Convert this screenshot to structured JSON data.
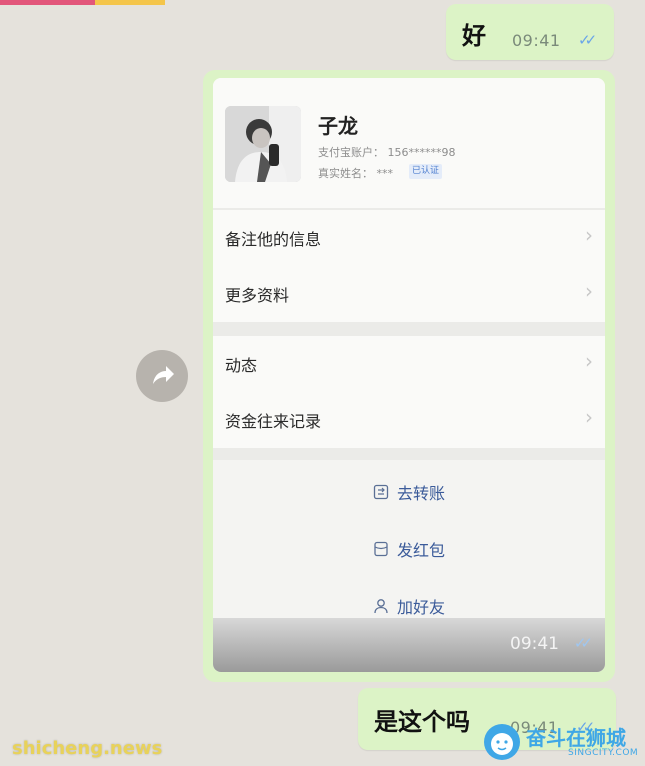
{
  "messages": {
    "first": {
      "text": "好",
      "time": "09:41",
      "ticks": "✓✓"
    },
    "last": {
      "text": "是这个吗",
      "time": "09:41",
      "ticks": "✓✓"
    }
  },
  "card": {
    "profile": {
      "name": "子龙",
      "account_label": "支付宝账户：",
      "account_value": "156******98",
      "realname_label": "真实姓名：",
      "realname_value": "***",
      "verified": "已认证"
    },
    "rows": [
      {
        "label": "备注他的信息"
      },
      {
        "label": "更多资料"
      },
      {
        "label": "动态"
      },
      {
        "label": "资金往来记录"
      }
    ],
    "actions": [
      {
        "label": "去转账",
        "icon": "transfer-icon"
      },
      {
        "label": "发红包",
        "icon": "red-packet-icon"
      },
      {
        "label": "加好友",
        "icon": "add-friend-icon"
      }
    ],
    "time": "09:41",
    "ticks": "✓✓"
  },
  "watermarks": {
    "left": "shicheng.news",
    "brand_cn": "奋斗在狮城",
    "brand_en": "SINGCITY.COM"
  },
  "colors": {
    "outgoing_bubble": "#dcf3c6",
    "chat_background": "#e5e2dc",
    "action_text": "#3b5b9a",
    "read_ticks": "#6aa5e8"
  }
}
